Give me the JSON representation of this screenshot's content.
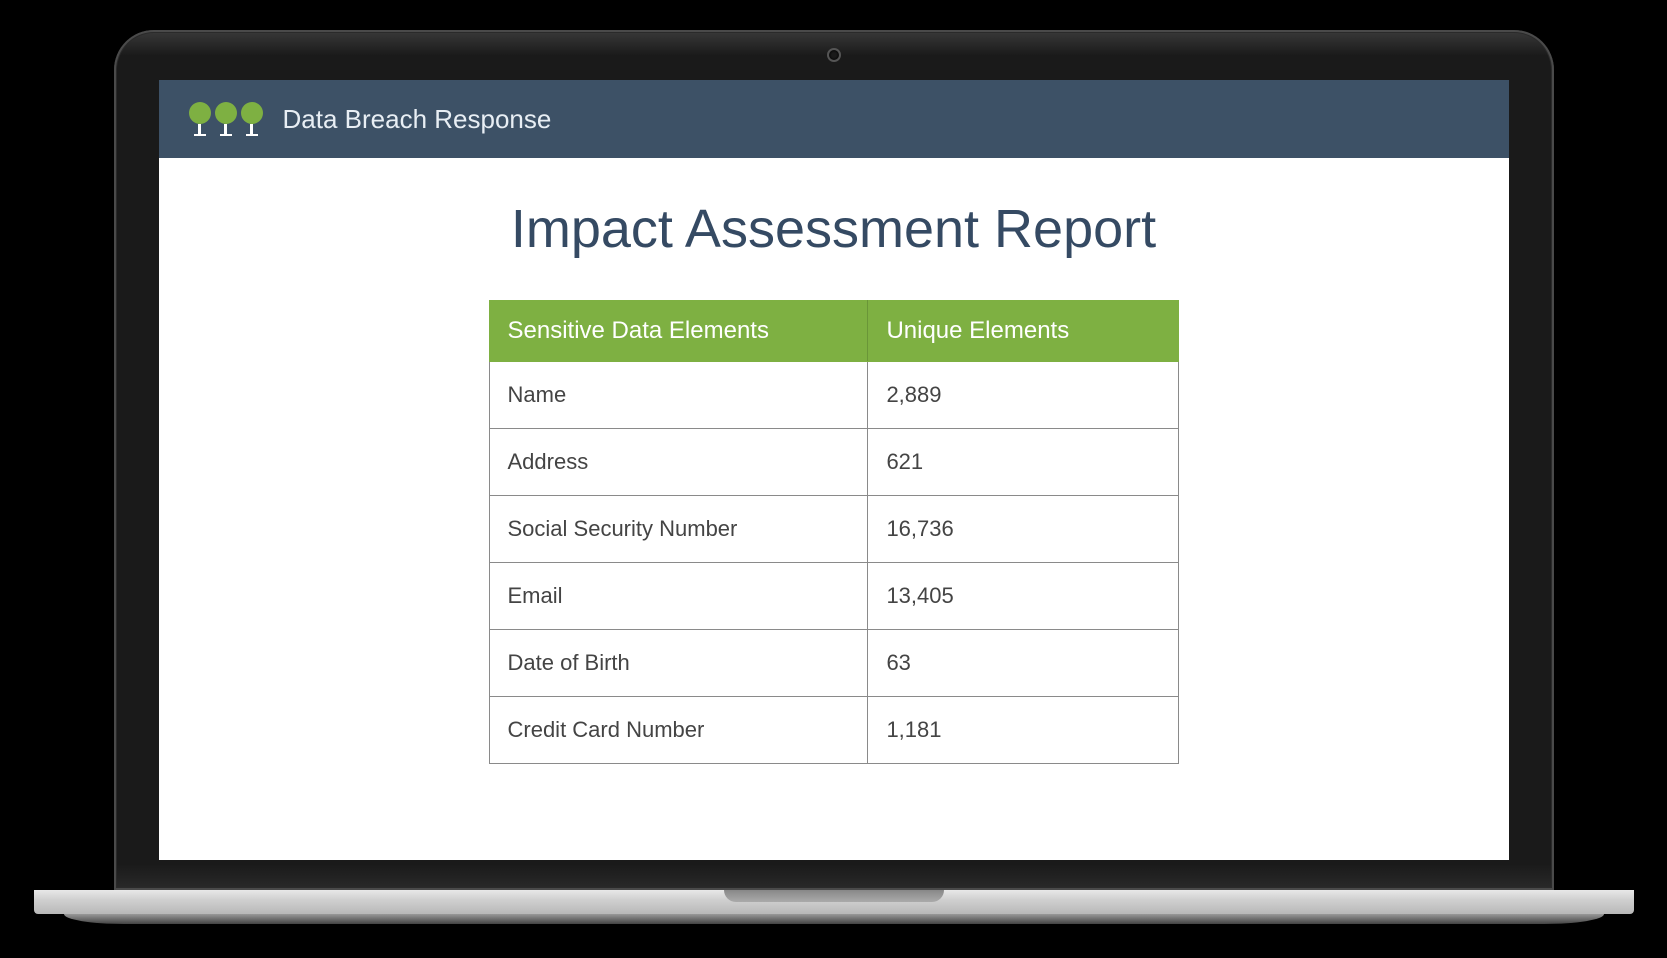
{
  "header": {
    "title": "Data Breach Response"
  },
  "page": {
    "title": "Impact Assessment Report"
  },
  "table": {
    "columns": [
      "Sensitive Data Elements",
      "Unique Elements"
    ],
    "rows": [
      {
        "element": "Name",
        "count": "2,889"
      },
      {
        "element": "Address",
        "count": "621"
      },
      {
        "element": "Social Security Number",
        "count": "16,736"
      },
      {
        "element": "Email",
        "count": "13,405"
      },
      {
        "element": "Date of Birth",
        "count": "63"
      },
      {
        "element": "Credit Card Number",
        "count": "1,181"
      }
    ]
  },
  "colors": {
    "header_bg": "#3d5166",
    "accent_green": "#7eb042",
    "title_color": "#354a63"
  }
}
